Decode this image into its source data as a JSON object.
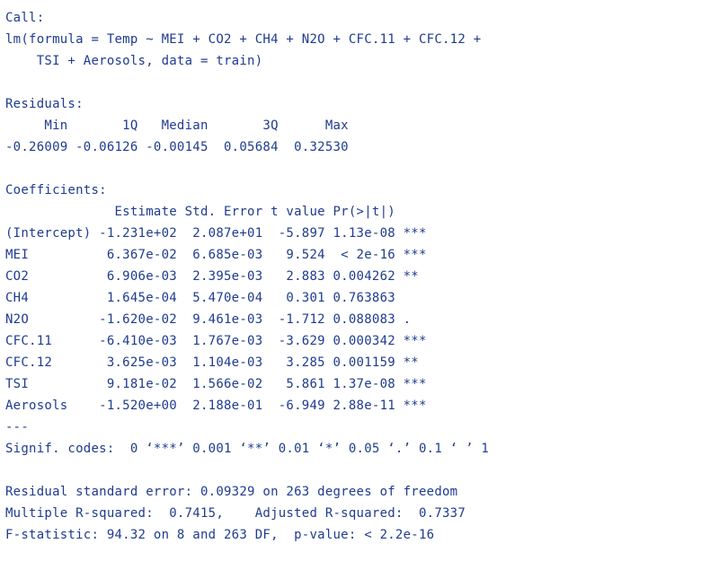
{
  "output": {
    "lines": [
      "Call:",
      "lm(formula = Temp ~ MEI + CO2 + CH4 + N2O + CFC.11 + CFC.12 +",
      "    TSI + Aerosols, data = train)",
      "",
      "Residuals:",
      "     Min       1Q   Median       3Q      Max ",
      "-0.26009 -0.06126 -0.00145  0.05684  0.32530 ",
      "",
      "Coefficients:",
      "              Estimate Std. Error t value Pr(>|t|)    ",
      "(Intercept) -1.231e+02  2.087e+01  -5.897 1.13e-08 ***",
      "MEI          6.367e-02  6.685e-03   9.524  < 2e-16 ***",
      "CO2          6.906e-03  2.395e-03   2.883 0.004262 ** ",
      "CH4          1.645e-04  5.470e-04   0.301 0.763863    ",
      "N2O         -1.620e-02  9.461e-03  -1.712 0.088083 .  ",
      "CFC.11      -6.410e-03  1.767e-03  -3.629 0.000342 ***",
      "CFC.12       3.625e-03  1.104e-03   3.285 0.001159 ** ",
      "TSI          9.181e-02  1.566e-02   5.861 1.37e-08 ***",
      "Aerosols    -1.520e+00  2.188e-01  -6.949 2.88e-11 ***",
      "---",
      "Signif. codes:  0 ‘***’ 0.001 ‘**’ 0.01 ‘*’ 0.05 ‘.’ 0.1 ‘ ’ 1",
      "",
      "Residual standard error: 0.09329 on 263 degrees of freedom",
      "Multiple R-squared:  0.7415,    Adjusted R-squared:  0.7337 ",
      "F-statistic: 94.32 on 8 and 263 DF,  p-value: < 2.2e-16"
    ]
  }
}
